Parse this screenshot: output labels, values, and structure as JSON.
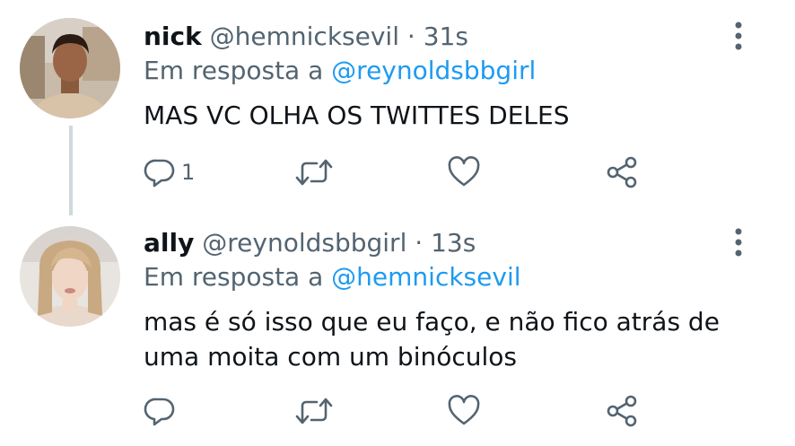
{
  "tweets": [
    {
      "display_name": "nick",
      "handle": "@hemnicksevil",
      "separator": "·",
      "time": "31s",
      "reply_prefix": "Em resposta a",
      "reply_to": "@reynoldsbbgirl",
      "text": "MAS VC OLHA OS TWITTES DELES",
      "reply_count": "1",
      "avatar_icon": "avatar-photo"
    },
    {
      "display_name": "ally",
      "handle": "@reynoldsbbgirl",
      "separator": "·",
      "time": "13s",
      "reply_prefix": "Em resposta a",
      "reply_to": "@hemnicksevil",
      "text": "mas é só isso que eu faço, e não fico atrás de uma moita com um binóculos",
      "reply_count": "",
      "avatar_icon": "avatar-photo"
    }
  ],
  "icons": {
    "reply": "reply-icon",
    "retweet": "retweet-icon",
    "like": "heart-icon",
    "share": "share-icon",
    "more": "more-options-icon"
  },
  "colors": {
    "text_primary": "#0f1419",
    "text_secondary": "#536471",
    "link": "#1d9bf0",
    "thread_line": "#cfd9de"
  }
}
